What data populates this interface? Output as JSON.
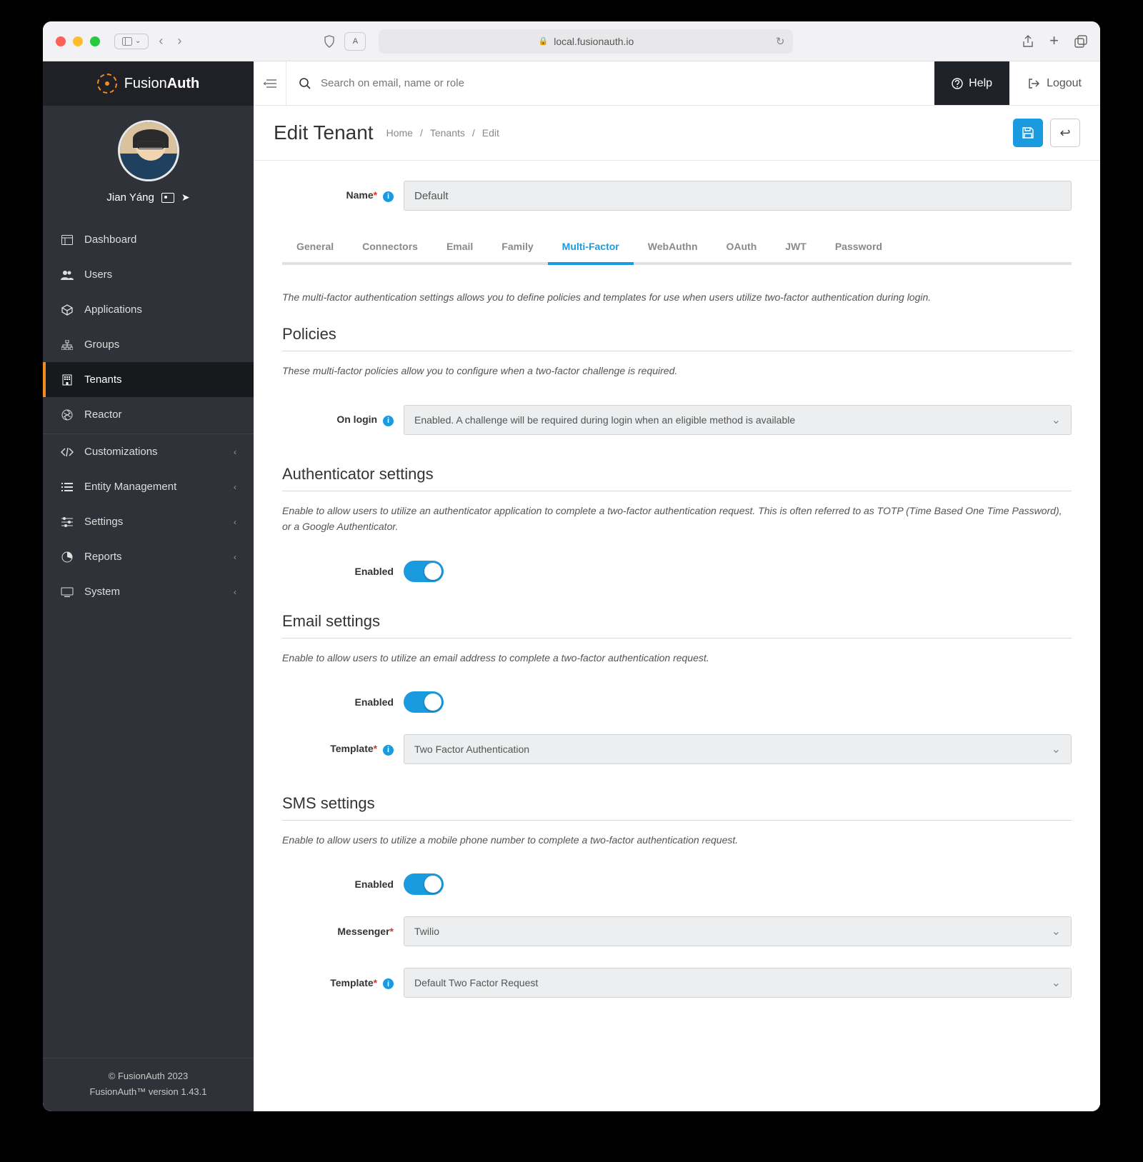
{
  "browser": {
    "url": "local.fusionauth.io"
  },
  "brand": "FusionAuth",
  "user": {
    "name": "Jian Yáng"
  },
  "sidebar": {
    "items": [
      {
        "label": "Dashboard"
      },
      {
        "label": "Users"
      },
      {
        "label": "Applications"
      },
      {
        "label": "Groups"
      },
      {
        "label": "Tenants"
      },
      {
        "label": "Reactor"
      }
    ],
    "groups": [
      {
        "label": "Customizations"
      },
      {
        "label": "Entity Management"
      },
      {
        "label": "Settings"
      },
      {
        "label": "Reports"
      },
      {
        "label": "System"
      }
    ]
  },
  "footer": {
    "copyright": "© FusionAuth 2023",
    "version": "FusionAuth™ version 1.43.1"
  },
  "topbar": {
    "search_placeholder": "Search on email, name or role",
    "help": "Help",
    "logout": "Logout"
  },
  "page": {
    "title": "Edit Tenant",
    "breadcrumb": [
      "Home",
      "Tenants",
      "Edit"
    ]
  },
  "form": {
    "name_label": "Name",
    "name_value": "Default"
  },
  "tabs": [
    "General",
    "Connectors",
    "Email",
    "Family",
    "Multi-Factor",
    "WebAuthn",
    "OAuth",
    "JWT",
    "Password"
  ],
  "active_tab": "Multi-Factor",
  "mfa": {
    "intro": "The multi-factor authentication settings allows you to define policies and templates for use when users utilize two-factor authentication during login.",
    "policies": {
      "title": "Policies",
      "desc": "These multi-factor policies allow you to configure when a two-factor challenge is required.",
      "on_login_label": "On login",
      "on_login_value": "Enabled. A challenge will be required during login when an eligible method is available"
    },
    "auth": {
      "title": "Authenticator settings",
      "desc": "Enable to allow users to utilize an authenticator application to complete a two-factor authentication request. This is often referred to as TOTP (Time Based One Time Password), or a Google Authenticator.",
      "enabled_label": "Enabled"
    },
    "email": {
      "title": "Email settings",
      "desc": "Enable to allow users to utilize an email address to complete a two-factor authentication request.",
      "enabled_label": "Enabled",
      "template_label": "Template",
      "template_value": "Two Factor Authentication"
    },
    "sms": {
      "title": "SMS settings",
      "desc": "Enable to allow users to utilize a mobile phone number to complete a two-factor authentication request.",
      "enabled_label": "Enabled",
      "messenger_label": "Messenger",
      "messenger_value": "Twilio",
      "template_label": "Template",
      "template_value": "Default Two Factor Request"
    }
  }
}
